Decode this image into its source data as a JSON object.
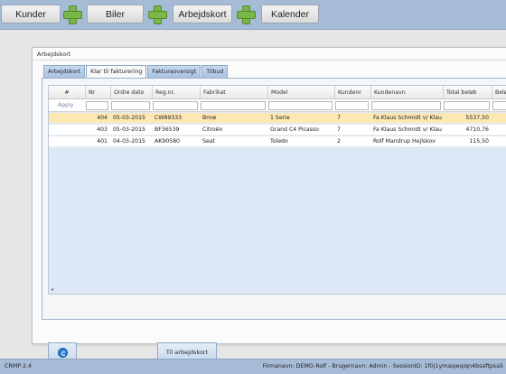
{
  "nav": {
    "kunder": "Kunder",
    "biler": "Biler",
    "arbejdskort": "Arbejdskort",
    "kalender": "Kalender"
  },
  "panel": {
    "title": "Arbejdskort",
    "tabs": [
      "Arbejdskort",
      "Klar til fakturering",
      "Fakturaoversigt",
      "Tilbud"
    ],
    "active_tab": "Klar til fakturering"
  },
  "grid": {
    "columns": [
      "#",
      "Nr",
      "Ordre dato",
      "Reg.nr.",
      "Fabrikat",
      "Model",
      "Kundenr",
      "Kundenavn",
      "Total beløb",
      "Beløb"
    ],
    "apply_label": "Apply",
    "rows": [
      {
        "nr": "404",
        "dato": "05-03-2015",
        "reg": "CW89333",
        "fabrikat": "Bmw",
        "model": "1 Serie",
        "kundenr": "7",
        "kundenavn": "Fa Klaus Schmidt v/ Klau",
        "total": "5537,50"
      },
      {
        "nr": "403",
        "dato": "05-03-2015",
        "reg": "BF36539",
        "fabrikat": "Citroën",
        "model": "Grand C4 Picasso",
        "kundenr": "7",
        "kundenavn": "Fa Klaus Schmidt v/ Klau",
        "total": "4710,76"
      },
      {
        "nr": "401",
        "dato": "04-03-2015",
        "reg": "AK90580",
        "fabrikat": "Seat",
        "model": "Toledo",
        "kundenr": "2",
        "kundenavn": "Rolf Mandrup Hejlskov",
        "total": "115,50"
      }
    ],
    "selected_row": 0
  },
  "buttons": {
    "til_arbejdskort": "Til arbejdskort",
    "refresh_icon": "refresh-icon"
  },
  "footer": {
    "version": "CRMP 2.4",
    "info": "Firmanavn: DEMO-Rolf - Brugernavn: Admin - SessionID: 1f0j1ymaqwqiqn4bsaftpsa5"
  },
  "colors": {
    "topbar": "#a6bcd6",
    "selected_row": "#fde8b4",
    "grid_bg": "#dce8f6",
    "plus_icon": "#7ab648"
  }
}
